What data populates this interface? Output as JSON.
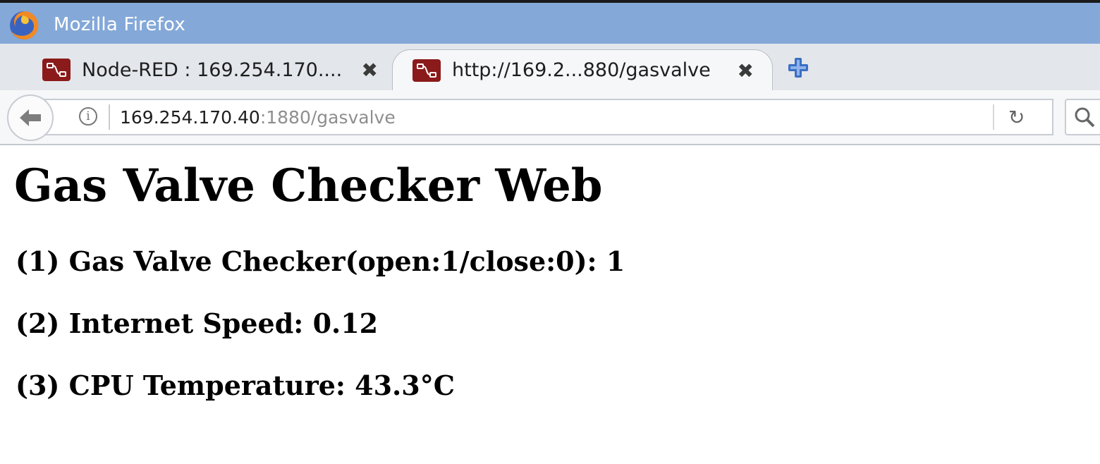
{
  "window": {
    "title": "Mozilla Firefox",
    "icon": "firefox-icon"
  },
  "colors": {
    "titlebar": "#84a8d8",
    "favicon": "#8b1a1a",
    "newtab_plus": "#3b6fc4"
  },
  "tabs": [
    {
      "label": "Node-RED : 169.254.170....",
      "close": "✖",
      "icon": "node-red-icon",
      "active": false
    },
    {
      "label": "http://169.2...880/gasvalve",
      "close": "✖",
      "icon": "node-red-icon",
      "active": true
    }
  ],
  "toolbar": {
    "new_tab_icon": "plus-icon",
    "back_icon": "back-arrow-icon",
    "info_icon": "info-icon",
    "reload_icon": "reload-icon",
    "search_icon": "search-icon",
    "info_glyph": "i",
    "reload_glyph": "↻"
  },
  "address": {
    "host": "169.254.170.40",
    "path": ":1880/gasvalve"
  },
  "page": {
    "title": "Gas Valve Checker Web",
    "items": [
      {
        "text": "(1) Gas Valve Checker(open:1/close:0): 1"
      },
      {
        "text": "(2) Internet Speed: 0.12"
      },
      {
        "text": "(3) CPU Temperature: 43.3°C"
      }
    ]
  }
}
